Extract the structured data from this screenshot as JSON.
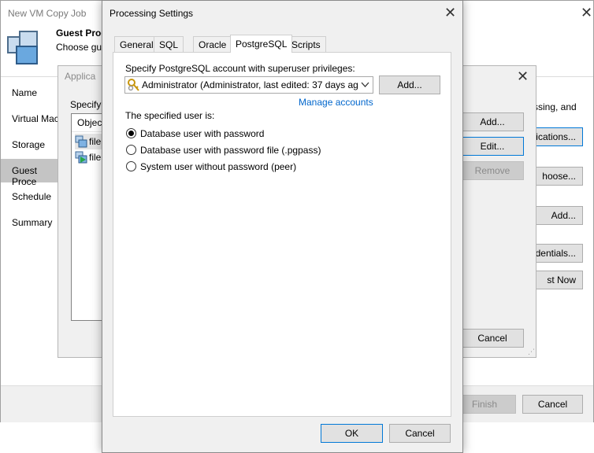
{
  "main_window": {
    "title": "New VM Copy Job",
    "header_title": "Guest Proc",
    "header_subtitle": "Choose gu",
    "nav": [
      {
        "label": "Name"
      },
      {
        "label": "Virtual Mac"
      },
      {
        "label": "Storage"
      },
      {
        "label": "Guest Proce"
      },
      {
        "label": "Schedule"
      },
      {
        "label": "Summary"
      }
    ],
    "selected_nav": "Guest Proce",
    "right_text": "ssing, and",
    "buttons": {
      "applications": "lications...",
      "choose": "hoose...",
      "add": "Add...",
      "credentials": "dentials...",
      "test_now": "st Now",
      "finish": "Finish",
      "cancel": "Cancel"
    }
  },
  "app_dialog": {
    "title": "Applica",
    "specify_label": "Specify",
    "list_header": "Object",
    "rows": [
      {
        "label": "file"
      },
      {
        "label": "file"
      }
    ],
    "buttons": {
      "add": "Add...",
      "edit": "Edit...",
      "remove": "Remove",
      "cancel": "Cancel"
    }
  },
  "processing_settings": {
    "title": "Processing Settings",
    "tabs": [
      {
        "label": "General"
      },
      {
        "label": "SQL"
      },
      {
        "label": "Oracle"
      },
      {
        "label": "PostgreSQL"
      },
      {
        "label": "Scripts"
      }
    ],
    "active_tab": "PostgreSQL",
    "account_label": "Specify PostgreSQL account with superuser privileges:",
    "account_value": "Administrator (Administrator, last edited: 37 days ag",
    "add_button": "Add...",
    "manage_accounts": "Manage accounts",
    "user_is_label": "The specified user is:",
    "options": [
      {
        "label": "Database user with password",
        "selected": true
      },
      {
        "label": "Database user with password file (.pgpass)",
        "selected": false
      },
      {
        "label": "System user without password (peer)",
        "selected": false
      }
    ],
    "ok": "OK",
    "cancel": "Cancel"
  },
  "colors": {
    "link": "#0066cc",
    "focus": "#0078d7",
    "selection": "#c4c4c4"
  }
}
